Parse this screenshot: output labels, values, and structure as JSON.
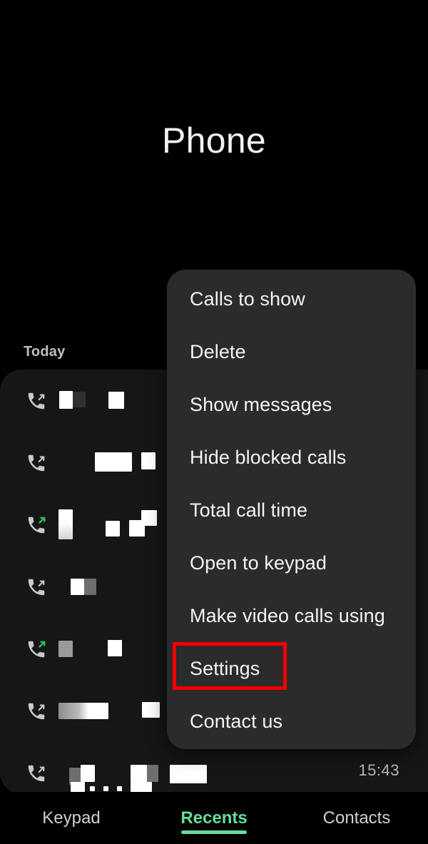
{
  "header": {
    "title": "Phone"
  },
  "list": {
    "section_label": "Today",
    "timestamp": "15:43",
    "rows": [
      {
        "call_type": "incoming",
        "icon": "incoming-call-icon"
      },
      {
        "call_type": "incoming",
        "icon": "incoming-call-icon"
      },
      {
        "call_type": "outgoing",
        "icon": "outgoing-call-icon"
      },
      {
        "call_type": "incoming",
        "icon": "incoming-call-icon"
      },
      {
        "call_type": "outgoing",
        "icon": "outgoing-call-icon"
      },
      {
        "call_type": "incoming",
        "icon": "incoming-call-icon"
      },
      {
        "call_type": "incoming",
        "icon": "incoming-call-icon"
      }
    ]
  },
  "menu": {
    "items": [
      {
        "label": "Calls to show"
      },
      {
        "label": "Delete"
      },
      {
        "label": "Show messages"
      },
      {
        "label": "Hide blocked calls"
      },
      {
        "label": "Total call time"
      },
      {
        "label": "Open to keypad"
      },
      {
        "label": "Make video calls using"
      },
      {
        "label": "Settings"
      },
      {
        "label": "Contact us"
      }
    ],
    "highlighted_item": "Settings"
  },
  "bottom_nav": {
    "tabs": [
      {
        "label": "Keypad",
        "active": false
      },
      {
        "label": "Recents",
        "active": true
      },
      {
        "label": "Contacts",
        "active": false
      }
    ]
  },
  "colors": {
    "background": "#000000",
    "menu_background": "#2b2b2b",
    "list_background": "#161616",
    "accent_green": "#63dd9c",
    "highlight_red": "#f20000",
    "text_primary": "#f4f4f4"
  }
}
